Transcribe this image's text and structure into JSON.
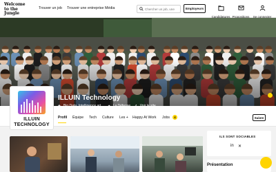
{
  "navbar": {
    "logo_line1": "Welcome",
    "logo_line2": "to the Jungle",
    "links": [
      "Trouver un job",
      "Trouver une entreprise",
      "Média"
    ],
    "search_placeholder": "Chercher un job, une",
    "employeurs_label": "Employeurs",
    "candidatures_label": "Candidatures",
    "propositions_label": "Propositions",
    "connect_label": "Se connecter"
  },
  "company": {
    "name": "ILLUIN Technology",
    "logo_line1": "ILLUIN",
    "logo_line2": "TECHNOLOGY",
    "meta": [
      "Big Data, Intelligence art…",
      "La Défense",
      "Voir le site"
    ]
  },
  "tabs": [
    "Profil",
    "Équipe",
    "Tech",
    "Culture",
    "Les +",
    "Happy At Work",
    "Jobs"
  ],
  "jobs_count": "4",
  "follow_label": "Suivre",
  "sidebar": {
    "social_title": "ILS SONT SOCIABLES",
    "presentation_title": "Présentation"
  },
  "colors": {
    "accent": "#ffd400",
    "navbar": "#ffffff"
  }
}
